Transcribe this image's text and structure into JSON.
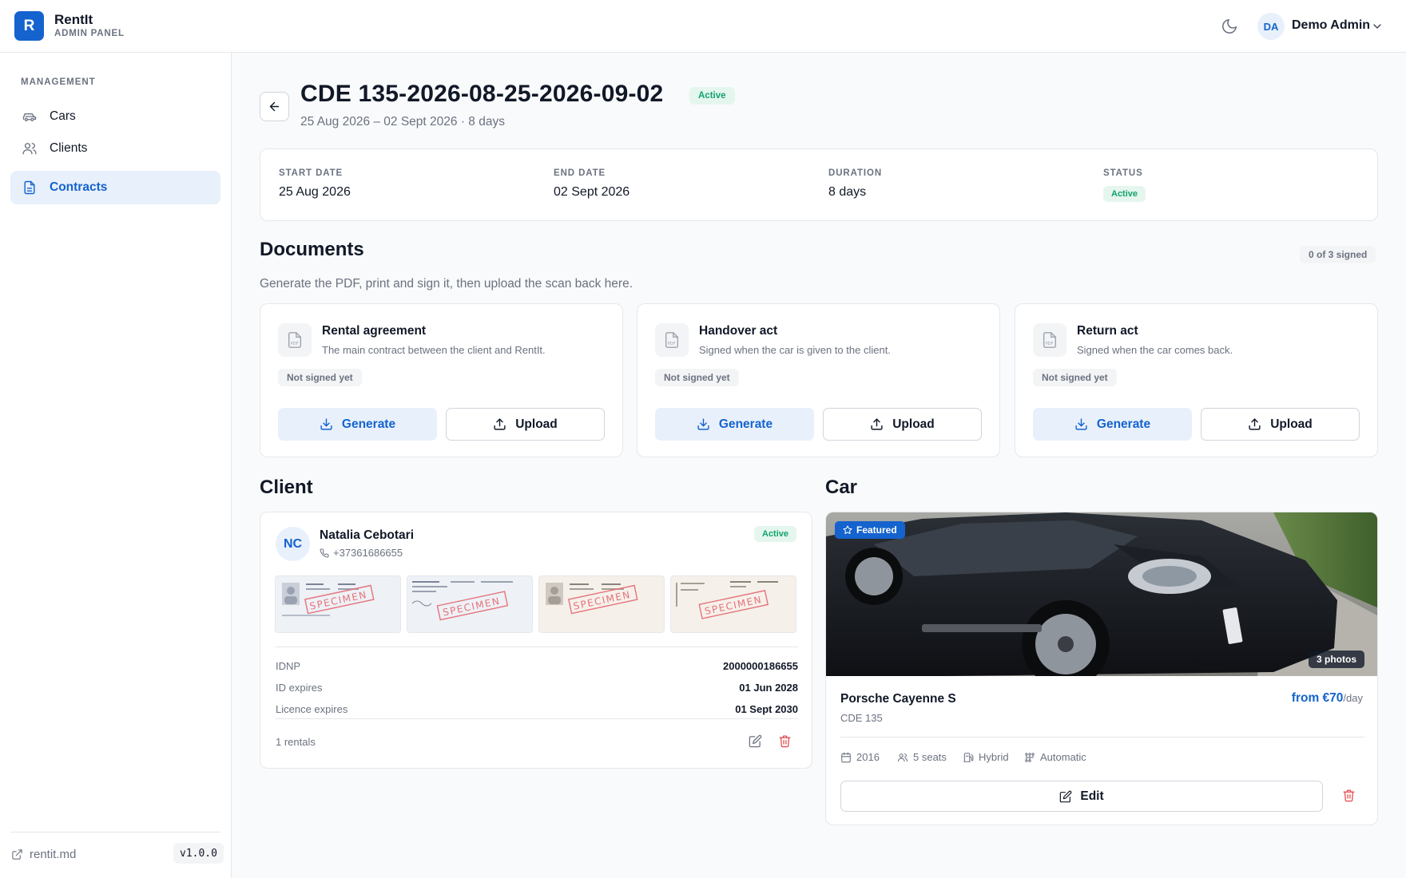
{
  "app": {
    "logo_letter": "R",
    "name": "RentIt",
    "subtitle": "ADMIN PANEL"
  },
  "user": {
    "initials": "DA",
    "name": "Demo Admin"
  },
  "sidebar": {
    "section": "MANAGEMENT",
    "items": [
      {
        "label": "Cars",
        "icon": "car-icon"
      },
      {
        "label": "Clients",
        "icon": "users-icon"
      },
      {
        "label": "Contracts",
        "icon": "document-icon",
        "active": true
      }
    ],
    "footer_link": "rentit.md",
    "version": "v1.0.0"
  },
  "contract": {
    "title": "CDE 135-2026-08-25-2026-09-02",
    "status": "Active",
    "subtitle": "25 Aug 2026 – 02 Sept 2026 · 8 days"
  },
  "summary": [
    {
      "label": "START DATE",
      "value": "25 Aug 2026"
    },
    {
      "label": "END DATE",
      "value": "02 Sept 2026"
    },
    {
      "label": "DURATION",
      "value": "8 days"
    },
    {
      "label": "STATUS",
      "value": "Active"
    }
  ],
  "documents": {
    "title": "Documents",
    "signed_count": "0 of 3 signed",
    "help": "Generate the PDF, print and sign it, then upload the scan back here.",
    "generate_label": "Generate",
    "upload_label": "Upload",
    "pdf_label": "PDF",
    "items": [
      {
        "name": "Rental agreement",
        "description": "The main contract between the client and RentIt.",
        "status": "Not signed yet"
      },
      {
        "name": "Handover act",
        "description": "Signed when the car is given to the client.",
        "status": "Not signed yet"
      },
      {
        "name": "Return act",
        "description": "Signed when the car comes back.",
        "status": "Not signed yet"
      }
    ]
  },
  "client": {
    "section_title": "Client",
    "initials": "NC",
    "name": "Natalia Cebotari",
    "phone": "+37361686655",
    "status": "Active",
    "specimen_label": "SPECIMEN",
    "fields": [
      {
        "key": "IDNP",
        "value": "2000000186655"
      },
      {
        "key": "ID expires",
        "value": "01 Jun 2028"
      },
      {
        "key": "Licence expires",
        "value": "01 Sept 2030"
      }
    ],
    "rentals": "1 rentals"
  },
  "car": {
    "section_title": "Car",
    "featured_label": "Featured",
    "photos": "3 photos",
    "name": "Porsche Cayenne S",
    "plate": "CDE 135",
    "price": "from €70",
    "price_unit": "/day",
    "specs": [
      {
        "label": "2016",
        "icon": "calendar-icon"
      },
      {
        "label": "5 seats",
        "icon": "users-icon"
      },
      {
        "label": "Hybrid",
        "icon": "fuel-icon"
      },
      {
        "label": "Automatic",
        "icon": "gearbox-icon"
      }
    ],
    "edit_label": "Edit"
  },
  "colors": {
    "accent": "#1463ce",
    "success": "#10a36b",
    "danger": "#e5484d"
  }
}
